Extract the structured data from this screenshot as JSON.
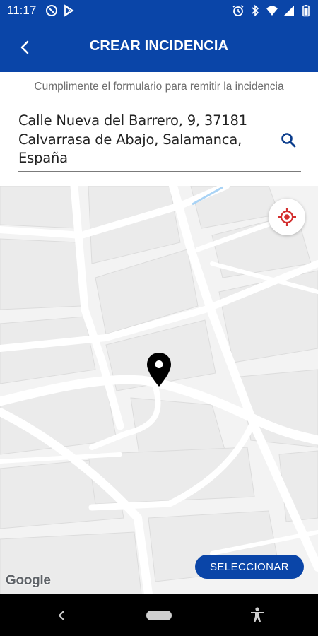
{
  "status_bar": {
    "time": "11:17",
    "left_icons": [
      "sync-icon",
      "play-store-icon"
    ],
    "right_icons": [
      "alarm-icon",
      "bluetooth-icon",
      "wifi-icon",
      "signal-icon",
      "battery-icon"
    ]
  },
  "app_bar": {
    "title": "CREAR INCIDENCIA",
    "back_icon": "chevron-left-icon",
    "background_color": "#0a45a8"
  },
  "form": {
    "instruction": "Cumplimente el formulario para remitir la incidencia",
    "address_value": "Calle Nueva del Barrero, 9, 37181\nCalvarrasa de Abajo, Salamanca,\nEspaña",
    "search_icon": "search-icon"
  },
  "map": {
    "provider_label": "Google",
    "locate_icon": "gps-target-icon",
    "pin_icon": "map-pin-icon",
    "select_label": "SELECCIONAR",
    "accent_color": "#0a45a8",
    "locate_color": "#d32f2f"
  },
  "nav_bar": {
    "icons": [
      "nav-back-icon",
      "nav-home-pill",
      "accessibility-icon"
    ]
  }
}
